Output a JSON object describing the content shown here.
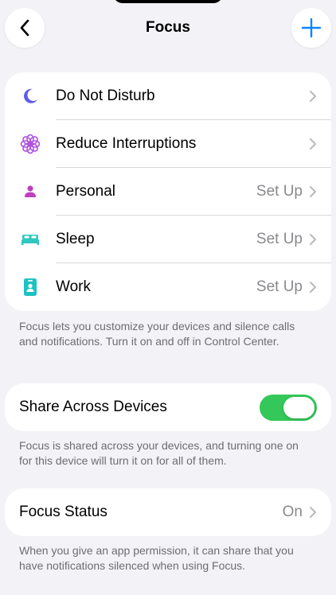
{
  "nav": {
    "title": "Focus",
    "back_icon": "chevron-left-icon",
    "add_icon": "plus-icon"
  },
  "focus_modes": [
    {
      "label": "Do Not Disturb",
      "detail": "",
      "icon": "moon-icon",
      "color": "#5E5CE6"
    },
    {
      "label": "Reduce Interruptions",
      "detail": "",
      "icon": "flower-icon",
      "color": "#AF52DE"
    },
    {
      "label": "Personal",
      "detail": "Set Up",
      "icon": "person-icon",
      "color": "#BF40BF"
    },
    {
      "label": "Sleep",
      "detail": "Set Up",
      "icon": "bed-icon",
      "color": "#30C7C0"
    },
    {
      "label": "Work",
      "detail": "Set Up",
      "icon": "badge-icon",
      "color": "#1FC2C2"
    }
  ],
  "focus_footnote": "Focus lets you customize your devices and silence calls and notifications. Turn it on and off in Control Center.",
  "share": {
    "label": "Share Across Devices",
    "enabled": true,
    "toggle_color": "#34C759",
    "footnote": "Focus is shared across your devices, and turning one on for this device will turn it on for all of them."
  },
  "status": {
    "label": "Focus Status",
    "value": "On",
    "footnote": "When you give an app permission, it can share that you have notifications silenced when using Focus."
  }
}
